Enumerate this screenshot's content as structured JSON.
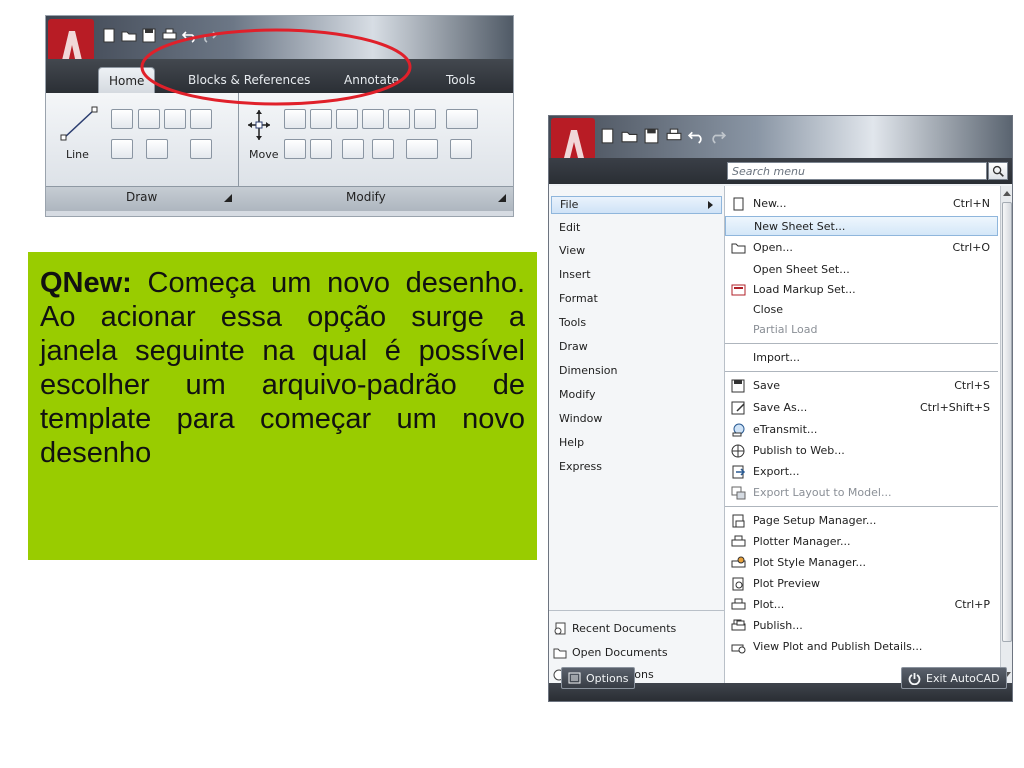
{
  "ribbon": {
    "tabs": [
      "Home",
      "Blocks & References",
      "Annotate",
      "Tools"
    ],
    "panels": [
      "Draw",
      "Modify"
    ],
    "tools": [
      "Line",
      "Move"
    ]
  },
  "note": {
    "title": "QNew:",
    "body": "Começa um novo desenho. Ao acionar essa opção surge a janela seguinte na qual é possível escolher um arquivo-padrão de template para começar um novo desenho"
  },
  "menu": {
    "search_placeholder": "Search menu",
    "left_items": [
      "File",
      "Edit",
      "View",
      "Insert",
      "Format",
      "Tools",
      "Draw",
      "Dimension",
      "Modify",
      "Window",
      "Help",
      "Express"
    ],
    "recent": [
      "Recent Documents",
      "Open Documents",
      "Recent Actions"
    ],
    "right_items": [
      {
        "label": "New...",
        "shortcut": "Ctrl+N"
      },
      {
        "label": "New Sheet Set..."
      },
      {
        "label": "Open...",
        "shortcut": "Ctrl+O"
      },
      {
        "label": "Open Sheet Set..."
      },
      {
        "label": "Load Markup Set..."
      },
      {
        "label": "Close"
      },
      {
        "label": "Partial Load"
      },
      {
        "label": "Import..."
      },
      {
        "label": "Save",
        "shortcut": "Ctrl+S"
      },
      {
        "label": "Save As...",
        "shortcut": "Ctrl+Shift+S"
      },
      {
        "label": "eTransmit..."
      },
      {
        "label": "Publish to Web..."
      },
      {
        "label": "Export..."
      },
      {
        "label": "Export Layout to Model..."
      },
      {
        "label": "Page Setup Manager..."
      },
      {
        "label": "Plotter Manager..."
      },
      {
        "label": "Plot Style Manager..."
      },
      {
        "label": "Plot Preview"
      },
      {
        "label": "Plot...",
        "shortcut": "Ctrl+P"
      },
      {
        "label": "Publish..."
      },
      {
        "label": "View Plot and Publish Details..."
      }
    ],
    "options_label": "Options",
    "exit_label": "Exit AutoCAD"
  },
  "colors": {
    "highlight_circle": "#e0202a",
    "note_bg": "#99cc00",
    "logo_red": "#c8202a"
  }
}
